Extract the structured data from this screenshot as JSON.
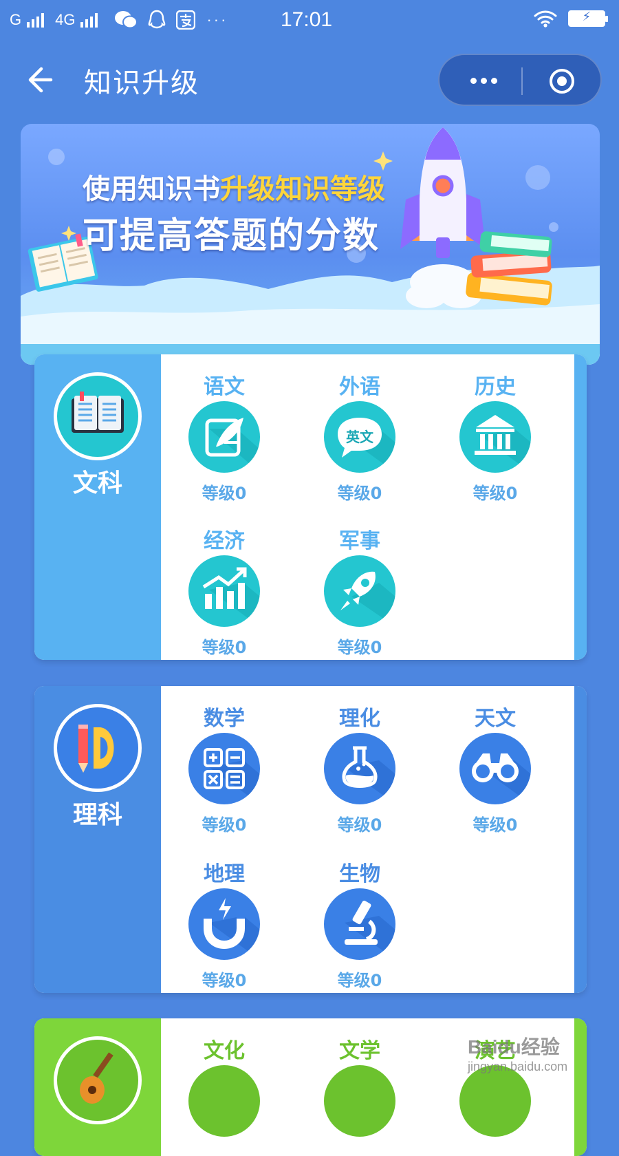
{
  "status_bar": {
    "carrier1": "G",
    "carrier2": "4G",
    "time": "17:01"
  },
  "nav": {
    "title": "知识升级"
  },
  "banner": {
    "line1_prefix": "使用知识书",
    "line1_highlight": "升级知识等级",
    "line2": "可提高答题的分数"
  },
  "colors": {
    "page_bg": "#4d86e0",
    "humanities_side": "#58b2f2",
    "humanities_circle": "#24c6d0",
    "science_side": "#4a8de3",
    "science_circle": "#3a80e6",
    "arts_side": "#7ed63a",
    "level_text": "#5aa8e8"
  },
  "sections": [
    {
      "category": "文科",
      "icon": "open-book-icon",
      "subjects": [
        {
          "name": "语文",
          "level": "等级0",
          "icon": "quill-paper-icon"
        },
        {
          "name": "外语",
          "level": "等级0",
          "icon": "speech-bubble-icon",
          "icon_text": "英文"
        },
        {
          "name": "历史",
          "level": "等级0",
          "icon": "museum-icon"
        },
        {
          "name": "经济",
          "level": "等级0",
          "icon": "growth-chart-icon"
        },
        {
          "name": "军事",
          "level": "等级0",
          "icon": "rocket-icon"
        }
      ]
    },
    {
      "category": "理科",
      "icon": "pencil-protractor-icon",
      "subjects": [
        {
          "name": "数学",
          "level": "等级0",
          "icon": "calculator-icon"
        },
        {
          "name": "理化",
          "level": "等级0",
          "icon": "flask-icon"
        },
        {
          "name": "天文",
          "level": "等级0",
          "icon": "binoculars-icon"
        },
        {
          "name": "地理",
          "level": "等级0",
          "icon": "magnet-icon"
        },
        {
          "name": "生物",
          "level": "等级0",
          "icon": "microscope-icon"
        }
      ]
    },
    {
      "category": "",
      "icon": "guitar-icon",
      "subjects": [
        {
          "name": "文化",
          "icon": "culture-icon"
        },
        {
          "name": "文学",
          "icon": "literature-icon"
        },
        {
          "name": "演艺",
          "icon": "performance-icon"
        }
      ]
    }
  ],
  "watermark": {
    "brand": "Baidu经验",
    "url": "jingyan.baidu.com"
  }
}
